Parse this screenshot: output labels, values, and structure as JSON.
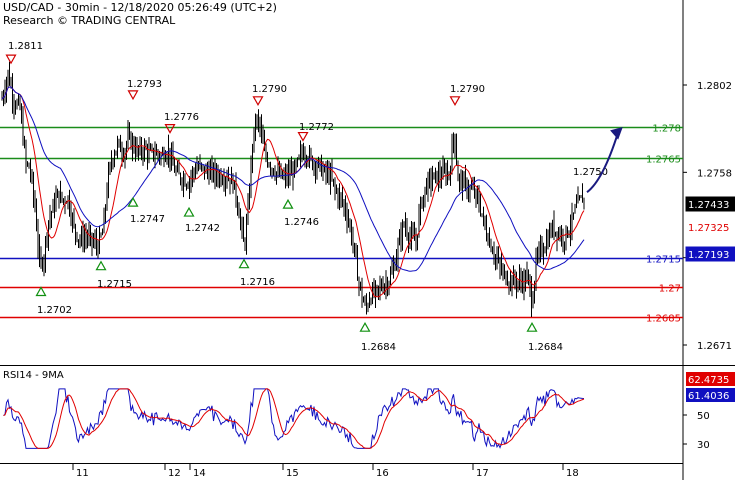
{
  "header": {
    "line1": "USD/CAD - 30min - 12/18/2020 05:26:49 (UTC+2)",
    "line2": "Research © TRADING CENTRAL"
  },
  "chart_data": [
    {
      "type": "line",
      "name": "price-panel",
      "ylim": [
        1.2662,
        1.2831
      ],
      "y_ticks": [
        "1.2802",
        "1.2758",
        "1.2715",
        "1.2671"
      ],
      "x_ticks": [
        "11",
        "12",
        "14",
        "15",
        "16",
        "17",
        "18"
      ],
      "series": [
        {
          "style": "bar-ohlc",
          "color": "#000000"
        },
        {
          "style": "line",
          "color": "#e00000"
        },
        {
          "style": "line",
          "color": "#1010c0"
        }
      ],
      "horizontal_levels": [
        {
          "value": 1.2781,
          "label": "1.278",
          "color": "#1a8c1a",
          "label_color": "#1a8c1a"
        },
        {
          "value": 1.2765,
          "label": "1.2765",
          "color": "#1a8c1a",
          "label_color": "#1a8c1a"
        },
        {
          "value": 1.2715,
          "label": "1.2715",
          "color": "#1010c0",
          "label_color": "#1010c0"
        },
        {
          "value": 1.27,
          "label": "1.27",
          "color": "#e00000",
          "label_color": "#e00000"
        },
        {
          "value": 1.2685,
          "label": "1.2685",
          "color": "#e00000",
          "label_color": "#e00000"
        }
      ],
      "price_tags": [
        {
          "value": 1.27433,
          "label": "1.27433",
          "bg": "#000000",
          "fg": "#ffffff"
        },
        {
          "value": 1.27325,
          "label": "1.27325",
          "bg": "#ffffff",
          "fg": "#e00000"
        },
        {
          "value": 1.27193,
          "label": "1.27193",
          "bg": "#1010c0",
          "fg": "#ffffff"
        }
      ],
      "swing_highs": [
        "1.2811",
        "1.2793",
        "1.2776",
        "1.2790",
        "1.2772",
        "1.2790",
        "1.2750"
      ],
      "swing_lows": [
        "1.2702",
        "1.2715",
        "1.2747",
        "1.2742",
        "1.2716",
        "1.2746",
        "1.2684",
        "1.2684"
      ],
      "forecast_arrow": {
        "to": 1.2781,
        "color": "#1a1a80"
      }
    },
    {
      "type": "line",
      "name": "indicator-panel",
      "title": "RSI14 - 9MA",
      "ylim": [
        20,
        80
      ],
      "y_ticks": [
        "50",
        "30"
      ],
      "series": [
        {
          "name": "RSI14",
          "color": "#1010c0"
        },
        {
          "name": "9MA",
          "color": "#e00000"
        }
      ],
      "value_tags": [
        {
          "value": 62.4735,
          "label": "62.4735",
          "bg": "#e00000",
          "fg": "#ffffff"
        },
        {
          "value": 61.4036,
          "label": "61.4036",
          "bg": "#1010c0",
          "fg": "#ffffff"
        }
      ]
    }
  ]
}
